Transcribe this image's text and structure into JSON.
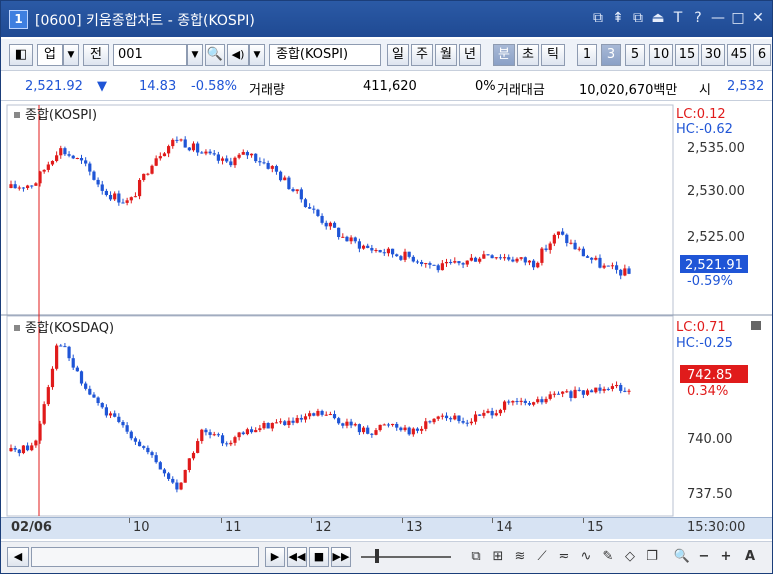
{
  "window": {
    "badge": "1",
    "title": "[0600] 키움종합차트 - 종합(KOSPI)",
    "controls": [
      "⧉",
      "⇞",
      "⧉",
      "⏏",
      "T",
      "?",
      "—",
      "□",
      "✕"
    ]
  },
  "toolbar": {
    "category": "업",
    "prev_label": "전",
    "code": "001",
    "name": "종합(KOSPI)",
    "period_buttons": [
      "일",
      "주",
      "월",
      "년",
      "분",
      "초",
      "틱"
    ],
    "selected_period": "분",
    "interval_buttons": [
      "1",
      "3",
      "5",
      "10",
      "15",
      "30",
      "45",
      "6"
    ],
    "selected_interval": "3"
  },
  "info": {
    "price": "2,521.92",
    "arrow": "▼",
    "change": "14.83",
    "change_pct": "-0.58%",
    "volume_label": "거래량",
    "volume": "411,620",
    "volume_pct": "0%",
    "amount_label": "거래대금",
    "amount": "10,020,670백만",
    "open_label": "시",
    "open_value": "2,532"
  },
  "panels": {
    "kospi": {
      "title": "종합(KOSPI)",
      "lc": "LC:0.12",
      "hc": "HC:-0.62",
      "y_ticks": [
        "2,535.00",
        "2,530.00",
        "2,525.00"
      ],
      "last_value": "2,521.91",
      "last_pct": "-0.59%",
      "range": [
        2518.5,
        2538.0
      ]
    },
    "kosdaq": {
      "title": "종합(KOSDAQ)",
      "lc": "LC:0.71",
      "hc": "HC:-0.25",
      "y_ticks": [
        "740.00",
        "737.50"
      ],
      "last_value": "742.85",
      "last_pct": "0.34%",
      "range": [
        736.5,
        746.0
      ]
    }
  },
  "xaxis": {
    "labels": [
      "02/06",
      "10",
      "11",
      "12",
      "13",
      "14",
      "15"
    ],
    "time": "15:30:00"
  },
  "colors": {
    "up": "#e01b1b",
    "down": "#1f55d6",
    "title_bar": "#1f4a93",
    "axis_bg": "#d7e3f3"
  },
  "chart_data": [
    {
      "type": "candlestick",
      "title": "종합(KOSPI)",
      "x": [
        "02/06",
        "10",
        "11",
        "12",
        "13",
        "14",
        "15"
      ],
      "series": [
        {
          "name": "종합(KOSPI)",
          "close_points": [
            2530.5,
            2531.0,
            2534.5,
            2533.0,
            2530.0,
            2529.0,
            2533.5,
            2535.5,
            2534.0,
            2533.0,
            2534.0,
            2532.5,
            2530.0,
            2527.5,
            2525.5,
            2524.5,
            2524.0,
            2523.5,
            2522.5,
            2523.0,
            2524.0,
            2523.5,
            2523.0,
            2526.0,
            2524.0,
            2522.5,
            2521.9
          ]
        }
      ],
      "ylim": [
        2518.5,
        2538.0
      ]
    },
    {
      "type": "candlestick",
      "title": "종합(KOSDAQ)",
      "x": [
        "02/06",
        "10",
        "11",
        "12",
        "13",
        "14",
        "15"
      ],
      "series": [
        {
          "name": "종합(KOSDAQ)",
          "close_points": [
            739.5,
            739.8,
            745.5,
            743.0,
            741.5,
            740.5,
            739.0,
            737.5,
            740.5,
            740.0,
            740.5,
            741.0,
            741.0,
            741.5,
            741.0,
            740.5,
            741.0,
            740.5,
            741.5,
            741.0,
            741.5,
            742.0,
            742.0,
            742.5,
            742.5,
            743.0,
            742.85
          ]
        }
      ],
      "ylim": [
        736.5,
        746.0
      ]
    }
  ]
}
